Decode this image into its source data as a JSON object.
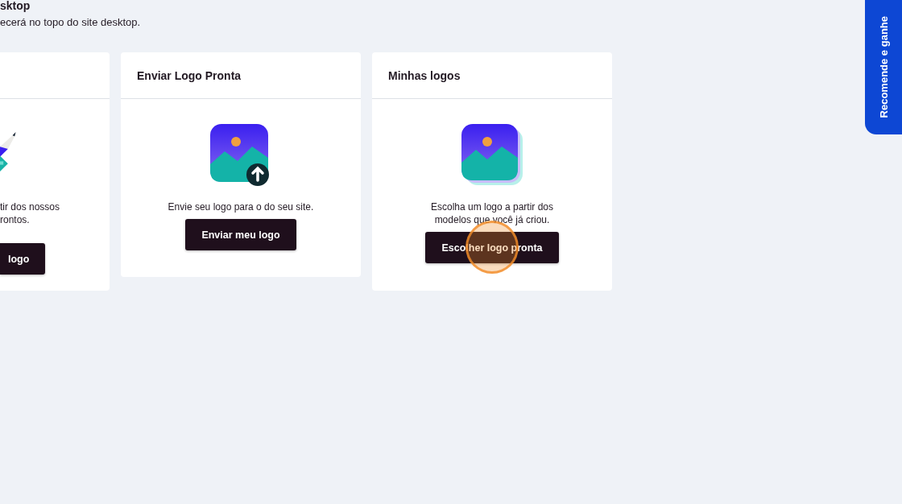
{
  "header": {
    "title": "sktop",
    "subtitle": "ecerá no topo do site desktop."
  },
  "cards": [
    {
      "kind": "pencil",
      "cut": true,
      "description_lines": [
        "tir dos nossos",
        "rontos."
      ],
      "button": "logo"
    },
    {
      "kind": "upload",
      "cut": false,
      "title": "Enviar Logo Pronta",
      "description_lines": [
        "Envie seu logo para o do seu site."
      ],
      "button": "Enviar meu logo"
    },
    {
      "kind": "stack",
      "cut": false,
      "title": "Minhas logos",
      "description_lines": [
        "Escolha um logo a partir dos",
        "modelos que você já criou."
      ],
      "button": "Escolher logo pronta",
      "clicked": true
    }
  ],
  "side_tab": {
    "label": "Recomende e ganhe"
  }
}
